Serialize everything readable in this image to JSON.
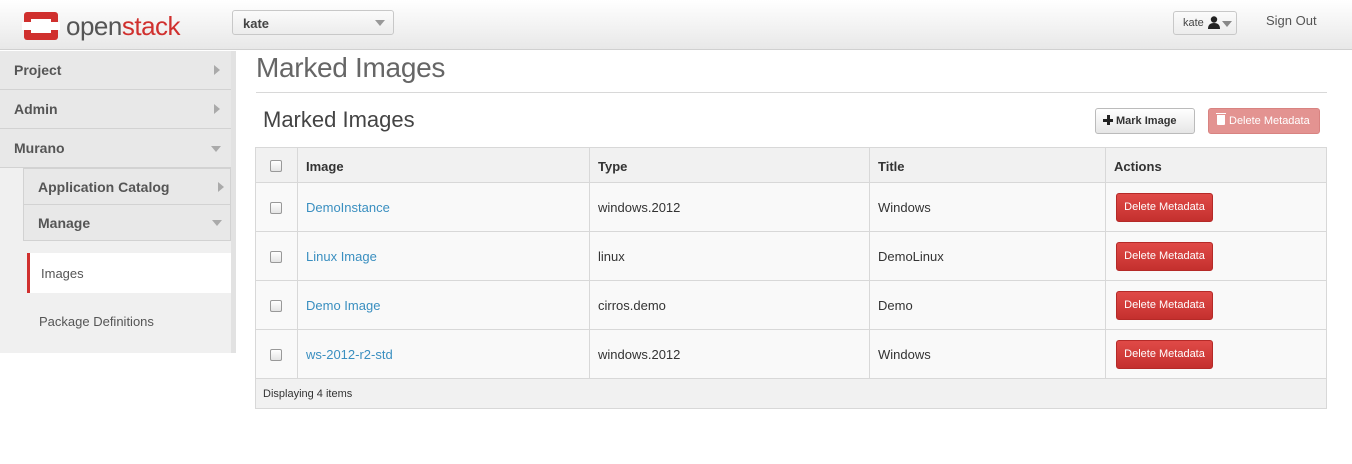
{
  "brand": {
    "part1": "open",
    "part2": "stack",
    "accent_color": "#d0302e"
  },
  "topbar": {
    "project": "kate",
    "user": "kate",
    "user_icon": "user-icon",
    "signout": "Sign Out"
  },
  "sidebar": {
    "sections": [
      {
        "label": "Project",
        "state": "collapsed"
      },
      {
        "label": "Admin",
        "state": "collapsed"
      },
      {
        "label": "Murano",
        "state": "expanded"
      }
    ],
    "subsections": [
      {
        "label": "Application Catalog",
        "state": "collapsed"
      },
      {
        "label": "Manage",
        "state": "expanded"
      }
    ],
    "items": [
      {
        "label": "Images",
        "active": true
      },
      {
        "label": "Package Definitions",
        "active": false
      }
    ]
  },
  "main": {
    "page_title": "Marked Images",
    "table_title": "Marked Images",
    "mark_image_label": "Mark Image",
    "delete_metadata_label": "Delete Metadata"
  },
  "table": {
    "columns": [
      "Image",
      "Type",
      "Title",
      "Actions"
    ],
    "rows": [
      {
        "image": "DemoInstance",
        "type": "windows.2012",
        "title": "Windows",
        "action": "Delete Metadata"
      },
      {
        "image": "Linux Image",
        "type": "linux",
        "title": "DemoLinux",
        "action": "Delete Metadata"
      },
      {
        "image": "Demo Image",
        "type": "cirros.demo",
        "title": "Demo",
        "action": "Delete Metadata"
      },
      {
        "image": "ws-2012-r2-std",
        "type": "windows.2012",
        "title": "Windows",
        "action": "Delete Metadata"
      }
    ],
    "footer": "Displaying 4 items"
  }
}
